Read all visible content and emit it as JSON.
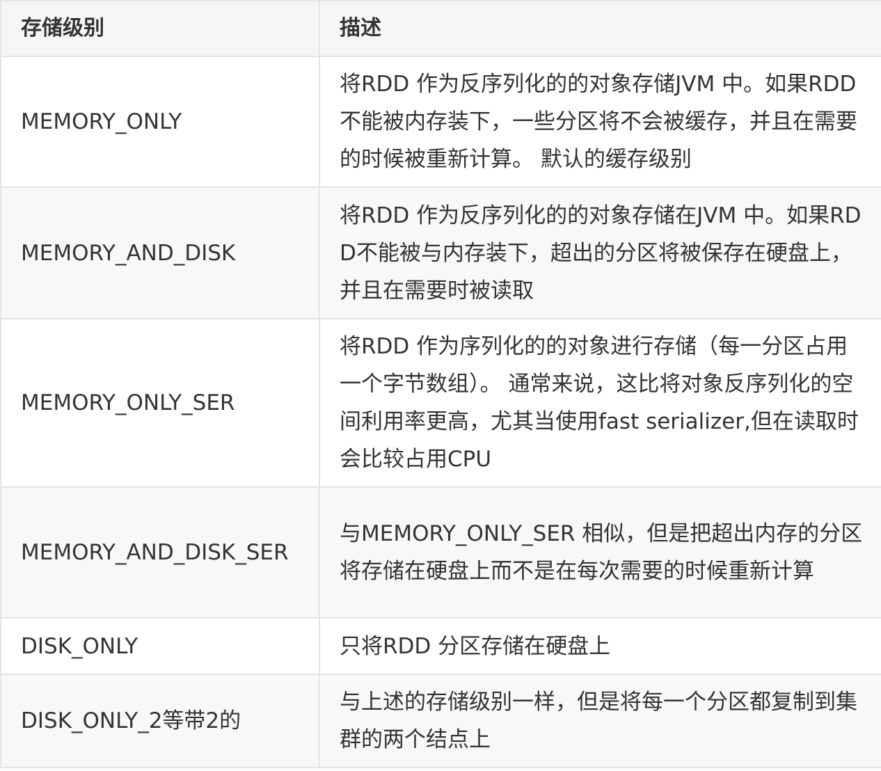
{
  "table": {
    "headers": [
      "存储级别",
      "描述"
    ],
    "rows": [
      {
        "level": "MEMORY_ONLY",
        "desc": "将RDD 作为反序列化的的对象存储JVM 中。如果RDD不能被内存装下，一些分区将不会被缓存，并且在需要的时候被重新计算。 默认的缓存级别"
      },
      {
        "level": "MEMORY_AND_DISK",
        "desc": "将RDD 作为反序列化的的对象存储在JVM 中。如果RDD不能被与内存装下，超出的分区将被保存在硬盘上，并且在需要时被读取"
      },
      {
        "level": "MEMORY_ONLY_SER",
        "desc": "将RDD 作为序列化的的对象进行存储（每一分区占用一个字节数组）。 通常来说，这比将对象反序列化的空间利用率更高，尤其当使用fast serializer,但在读取时会比较占用CPU"
      },
      {
        "level": "MEMORY_AND_DISK_SER",
        "desc": "与MEMORY_ONLY_SER 相似，但是把超出内存的分区将存储在硬盘上而不是在每次需要的时候重新计算"
      },
      {
        "level": "DISK_ONLY",
        "desc": "只将RDD 分区存储在硬盘上"
      },
      {
        "level": "DISK_ONLY_2等带2的",
        "desc": "与上述的存储级别一样，但是将每一个分区都复制到集群的两个结点上"
      }
    ]
  }
}
